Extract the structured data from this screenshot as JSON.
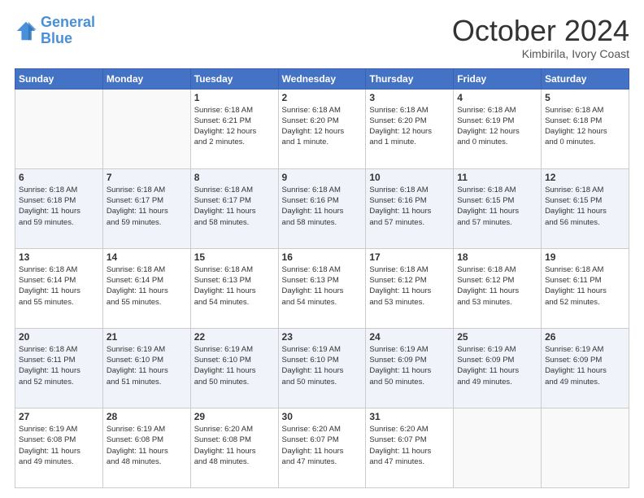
{
  "header": {
    "logo_line1": "General",
    "logo_line2": "Blue",
    "month": "October 2024",
    "location": "Kimbirila, Ivory Coast"
  },
  "days_of_week": [
    "Sunday",
    "Monday",
    "Tuesday",
    "Wednesday",
    "Thursday",
    "Friday",
    "Saturday"
  ],
  "weeks": [
    [
      {
        "day": "",
        "info": ""
      },
      {
        "day": "",
        "info": ""
      },
      {
        "day": "1",
        "info": "Sunrise: 6:18 AM\nSunset: 6:21 PM\nDaylight: 12 hours\nand 2 minutes."
      },
      {
        "day": "2",
        "info": "Sunrise: 6:18 AM\nSunset: 6:20 PM\nDaylight: 12 hours\nand 1 minute."
      },
      {
        "day": "3",
        "info": "Sunrise: 6:18 AM\nSunset: 6:20 PM\nDaylight: 12 hours\nand 1 minute."
      },
      {
        "day": "4",
        "info": "Sunrise: 6:18 AM\nSunset: 6:19 PM\nDaylight: 12 hours\nand 0 minutes."
      },
      {
        "day": "5",
        "info": "Sunrise: 6:18 AM\nSunset: 6:18 PM\nDaylight: 12 hours\nand 0 minutes."
      }
    ],
    [
      {
        "day": "6",
        "info": "Sunrise: 6:18 AM\nSunset: 6:18 PM\nDaylight: 11 hours\nand 59 minutes."
      },
      {
        "day": "7",
        "info": "Sunrise: 6:18 AM\nSunset: 6:17 PM\nDaylight: 11 hours\nand 59 minutes."
      },
      {
        "day": "8",
        "info": "Sunrise: 6:18 AM\nSunset: 6:17 PM\nDaylight: 11 hours\nand 58 minutes."
      },
      {
        "day": "9",
        "info": "Sunrise: 6:18 AM\nSunset: 6:16 PM\nDaylight: 11 hours\nand 58 minutes."
      },
      {
        "day": "10",
        "info": "Sunrise: 6:18 AM\nSunset: 6:16 PM\nDaylight: 11 hours\nand 57 minutes."
      },
      {
        "day": "11",
        "info": "Sunrise: 6:18 AM\nSunset: 6:15 PM\nDaylight: 11 hours\nand 57 minutes."
      },
      {
        "day": "12",
        "info": "Sunrise: 6:18 AM\nSunset: 6:15 PM\nDaylight: 11 hours\nand 56 minutes."
      }
    ],
    [
      {
        "day": "13",
        "info": "Sunrise: 6:18 AM\nSunset: 6:14 PM\nDaylight: 11 hours\nand 55 minutes."
      },
      {
        "day": "14",
        "info": "Sunrise: 6:18 AM\nSunset: 6:14 PM\nDaylight: 11 hours\nand 55 minutes."
      },
      {
        "day": "15",
        "info": "Sunrise: 6:18 AM\nSunset: 6:13 PM\nDaylight: 11 hours\nand 54 minutes."
      },
      {
        "day": "16",
        "info": "Sunrise: 6:18 AM\nSunset: 6:13 PM\nDaylight: 11 hours\nand 54 minutes."
      },
      {
        "day": "17",
        "info": "Sunrise: 6:18 AM\nSunset: 6:12 PM\nDaylight: 11 hours\nand 53 minutes."
      },
      {
        "day": "18",
        "info": "Sunrise: 6:18 AM\nSunset: 6:12 PM\nDaylight: 11 hours\nand 53 minutes."
      },
      {
        "day": "19",
        "info": "Sunrise: 6:18 AM\nSunset: 6:11 PM\nDaylight: 11 hours\nand 52 minutes."
      }
    ],
    [
      {
        "day": "20",
        "info": "Sunrise: 6:18 AM\nSunset: 6:11 PM\nDaylight: 11 hours\nand 52 minutes."
      },
      {
        "day": "21",
        "info": "Sunrise: 6:19 AM\nSunset: 6:10 PM\nDaylight: 11 hours\nand 51 minutes."
      },
      {
        "day": "22",
        "info": "Sunrise: 6:19 AM\nSunset: 6:10 PM\nDaylight: 11 hours\nand 50 minutes."
      },
      {
        "day": "23",
        "info": "Sunrise: 6:19 AM\nSunset: 6:10 PM\nDaylight: 11 hours\nand 50 minutes."
      },
      {
        "day": "24",
        "info": "Sunrise: 6:19 AM\nSunset: 6:09 PM\nDaylight: 11 hours\nand 50 minutes."
      },
      {
        "day": "25",
        "info": "Sunrise: 6:19 AM\nSunset: 6:09 PM\nDaylight: 11 hours\nand 49 minutes."
      },
      {
        "day": "26",
        "info": "Sunrise: 6:19 AM\nSunset: 6:09 PM\nDaylight: 11 hours\nand 49 minutes."
      }
    ],
    [
      {
        "day": "27",
        "info": "Sunrise: 6:19 AM\nSunset: 6:08 PM\nDaylight: 11 hours\nand 49 minutes."
      },
      {
        "day": "28",
        "info": "Sunrise: 6:19 AM\nSunset: 6:08 PM\nDaylight: 11 hours\nand 48 minutes."
      },
      {
        "day": "29",
        "info": "Sunrise: 6:20 AM\nSunset: 6:08 PM\nDaylight: 11 hours\nand 48 minutes."
      },
      {
        "day": "30",
        "info": "Sunrise: 6:20 AM\nSunset: 6:07 PM\nDaylight: 11 hours\nand 47 minutes."
      },
      {
        "day": "31",
        "info": "Sunrise: 6:20 AM\nSunset: 6:07 PM\nDaylight: 11 hours\nand 47 minutes."
      },
      {
        "day": "",
        "info": ""
      },
      {
        "day": "",
        "info": ""
      }
    ]
  ]
}
